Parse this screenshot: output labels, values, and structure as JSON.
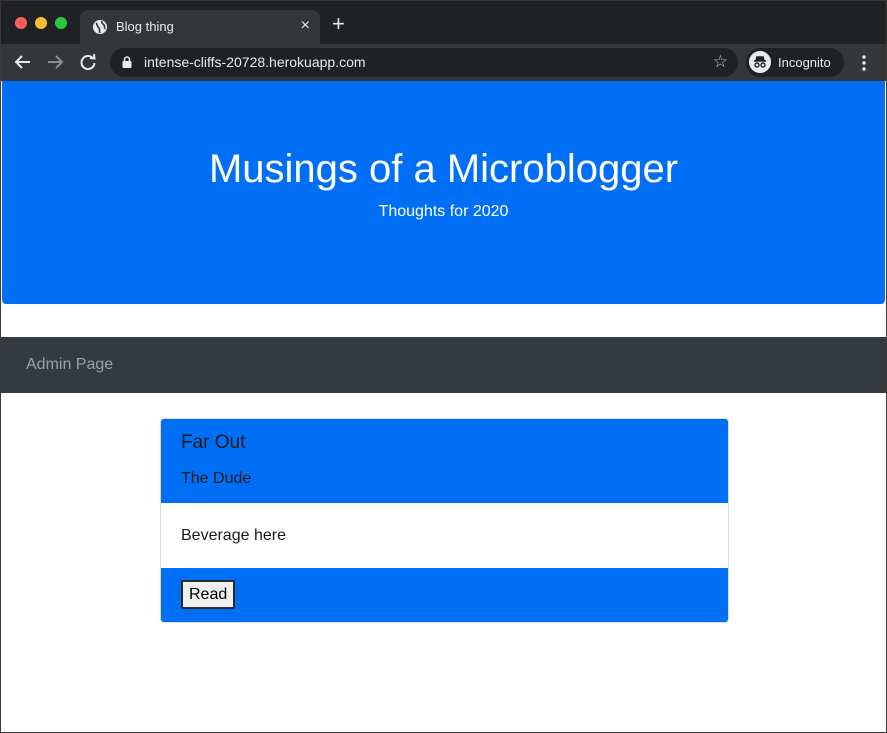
{
  "browser": {
    "tab_title": "Blog thing",
    "tab_close": "×",
    "new_tab": "+",
    "url": "intense-cliffs-20728.herokuapp.com",
    "star": "☆",
    "profile_label": "Incognito"
  },
  "colors": {
    "accent": "#006ff6",
    "navbar": "#343a40",
    "chrome_dark": "#202124",
    "chrome_toolbar": "#35363a"
  },
  "header": {
    "title": "Musings of a Microblogger",
    "subtitle": "Thoughts for 2020"
  },
  "nav": {
    "items": [
      {
        "label": "Admin Page"
      }
    ]
  },
  "posts": [
    {
      "title": "Far Out",
      "author": "The Dude",
      "body": "Beverage here",
      "button_label": "Read"
    }
  ],
  "icons": {
    "globe": "globe-icon",
    "back": "back-arrow-icon",
    "forward": "forward-arrow-icon",
    "reload": "reload-icon",
    "lock": "lock-icon",
    "star": "star-icon",
    "incognito": "incognito-icon",
    "menu": "more-vert-icon"
  }
}
